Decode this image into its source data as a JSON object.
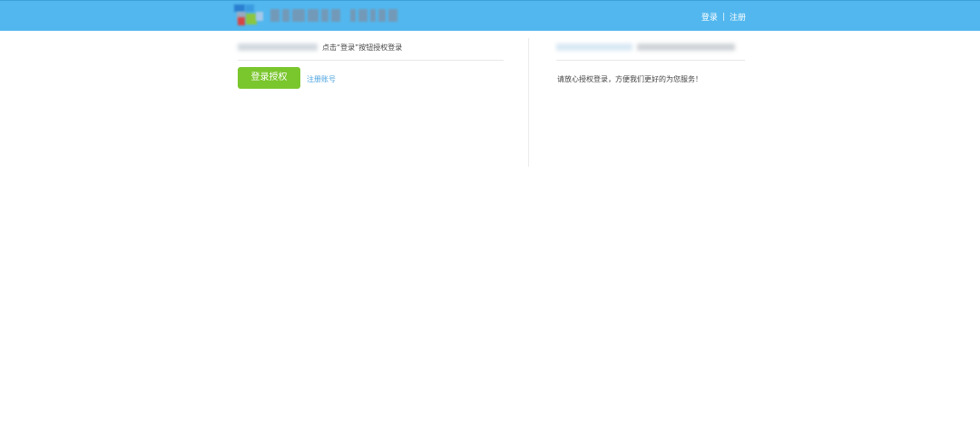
{
  "header": {
    "links": {
      "login": "登录",
      "separator": "|",
      "register": "注册"
    },
    "colors": {
      "bar": "#52b7ee"
    }
  },
  "left_panel": {
    "hint_text": "点击“登录”按钮授权登录",
    "login_button": "登录授权",
    "register_link": "注册账号",
    "colors": {
      "button": "#7ac62d",
      "link": "#4aa3df"
    }
  },
  "right_panel": {
    "message": "请放心授权登录，方便我们更好的为您服务！"
  }
}
